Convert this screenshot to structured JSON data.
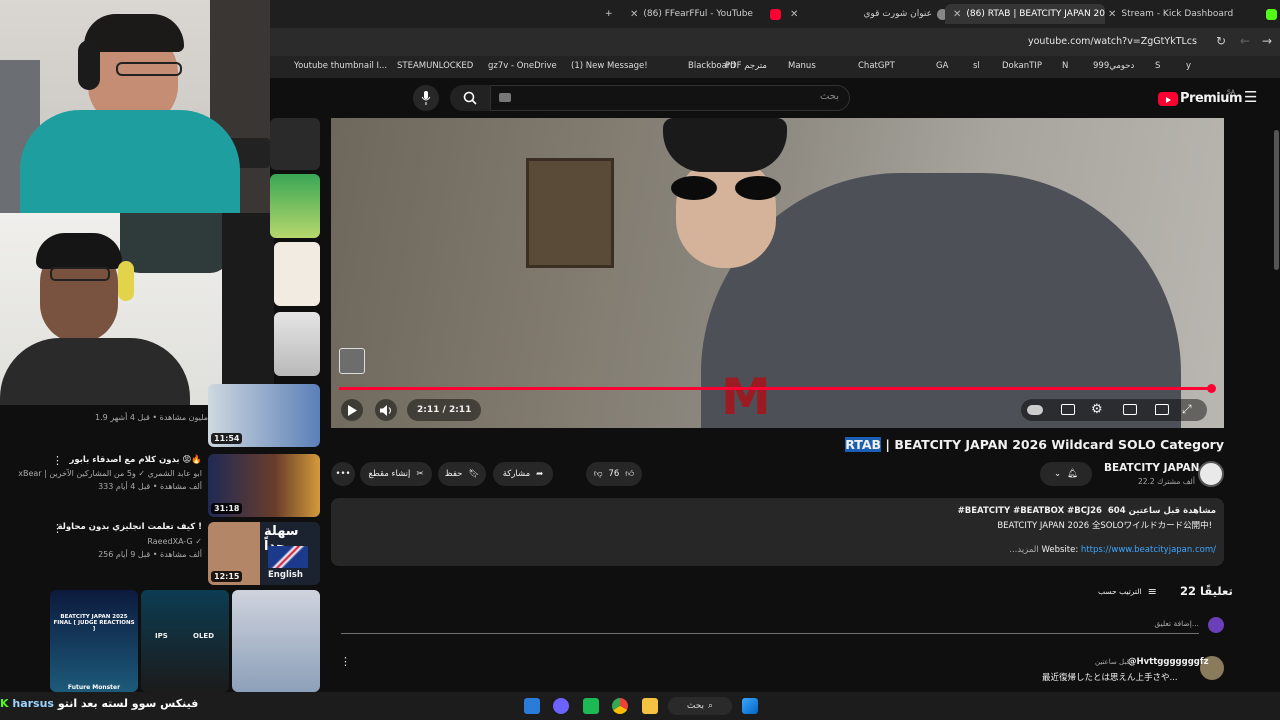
{
  "browser": {
    "tabs": [
      {
        "label": "(86) FFearFFul - YouTube"
      },
      {
        "label": "عنوان شورت قوي"
      },
      {
        "label": "(86) RTAB | BEATCITY JAPAN 20"
      },
      {
        "label": "Stream - Kick Dashboard"
      }
    ],
    "url": "youtube.com/watch?v=ZgGtYkTLcs",
    "bookmarks": [
      "Youtube thumbnail I...",
      "STEAMUNLOCKED",
      "gz7v - OneDrive",
      "(1) New Message!",
      "Blackboard",
      "PDF مترجم",
      "Manus",
      "ChatGPT",
      "GA",
      "sl",
      "DokanTIP",
      "N",
      "دحومي999",
      "S",
      "y"
    ]
  },
  "youtube": {
    "search_placeholder": "بحث",
    "logo": "Premium",
    "region": "SA"
  },
  "player": {
    "time": "2:11 / 2:11",
    "progress": 1.0
  },
  "video": {
    "title_highlight": "RTAB",
    "title_rest": " | BEATCITY JAPAN 2026 Wildcard SOLO Category",
    "channel": "BEATCITY JAPAN",
    "subscribers": "22.2 ألف مشترك",
    "likes": "76",
    "share": "مشاركة",
    "save": "حفظ",
    "clip": "إنشاء مقطع",
    "more": "•••"
  },
  "description": {
    "stats": "604 مشاهدة قبل ساعتين",
    "tags": "#BEATCITY #BEATBOX #BCJ26",
    "line1": "BEATCITY JAPAN 2026 全SOLOワイルドカード公開中!",
    "website_label": "Website: ",
    "website_link": "https://www.beatcityjapan.com/",
    "more": "...المزيد"
  },
  "comments": {
    "count": "22 تعليقًا",
    "sort": "الترتيب حسب",
    "add_placeholder": "إضافة تعليق...",
    "first_author": "@Hvttgggggggfz",
    "first_time": "قبل ساعتين",
    "first_text": "最近復帰したとは思えん上手さや..."
  },
  "sidebar": {
    "items": [
      {
        "meta1": "1.9 مليون مشاهدة • قبل 4 أشهر",
        "duration": "11:54"
      },
      {
        "title": "بدون كلام مع اصدقاء بابور 😡🔥",
        "channel": "xBear | ابو عابد الشمري ✓ و5 من المشاركين الآخرين",
        "meta": "333 ألف مشاهدة • قبل 4 أيام",
        "duration": "31:18"
      },
      {
        "title": "كيف تعلمت انجليزي بدون محاولة !",
        "channel": "RaeedXA-G ✓",
        "meta": "256 ألف مشاهدة • قبل 9 أيام",
        "duration": "12:15",
        "thumb_text1": "سهلة جداً",
        "thumb_text2": "English"
      }
    ],
    "shorts_label": "BEATCITY JAPAN 2025 FINAL [ JUDGE REACTIONS ]",
    "short2_a": "IPS",
    "short2_b": "OLED",
    "short1_caption": "Future Monster"
  },
  "stream_overlay": {
    "chat": "فينكس سوو لسته بعد انتو",
    "chat_user": "harsus"
  },
  "taskbar": {
    "search": "بحث"
  },
  "colors": {
    "yt_red": "#ff0033",
    "link_blue": "#3ea6ff",
    "highlight": "#1a5fb4"
  }
}
